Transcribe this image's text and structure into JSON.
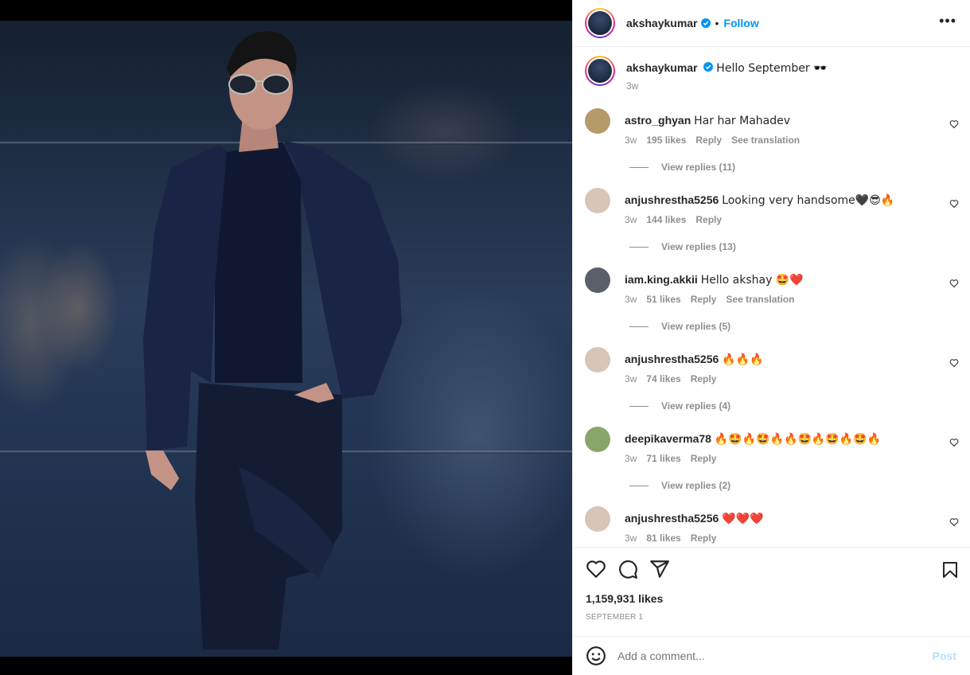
{
  "post": {
    "username": "akshaykumar",
    "follow_label": "Follow",
    "more_label": "•••",
    "caption": {
      "username": "akshaykumar",
      "text": "Hello September 🕶️",
      "age": "3w"
    },
    "likes": "1,159,931 likes",
    "date": "SEPTEMBER 1"
  },
  "comments": [
    {
      "username": "astro_ghyan",
      "text": "Har har Mahadev",
      "age": "3w",
      "likes": "195 likes",
      "reply": "Reply",
      "translation": "See translation",
      "view_replies": "View replies (11)",
      "avatar_color": "#b59a6a"
    },
    {
      "username": "anjushrestha5256",
      "text": "Looking very handsome🖤😎🔥",
      "age": "3w",
      "likes": "144 likes",
      "reply": "Reply",
      "translation": "",
      "view_replies": "View replies (13)",
      "avatar_color": "#d9c4b8"
    },
    {
      "username": "iam.king.akkii",
      "text": "Hello akshay 🤩❤️",
      "age": "3w",
      "likes": "51 likes",
      "reply": "Reply",
      "translation": "See translation",
      "view_replies": "View replies (5)",
      "avatar_color": "#5a5f6a"
    },
    {
      "username": "anjushrestha5256",
      "text": "🔥🔥🔥",
      "age": "3w",
      "likes": "74 likes",
      "reply": "Reply",
      "translation": "",
      "view_replies": "View replies (4)",
      "avatar_color": "#d9c4b8"
    },
    {
      "username": "deepikaverma78",
      "text": "🔥🤩🔥🤩🔥🔥🤩🔥🤩🔥🤩🔥",
      "age": "3w",
      "likes": "71 likes",
      "reply": "Reply",
      "translation": "",
      "view_replies": "View replies (2)",
      "avatar_color": "#8aa56a"
    },
    {
      "username": "anjushrestha5256",
      "text": "❤️❤️❤️",
      "age": "3w",
      "likes": "81 likes",
      "reply": "Reply",
      "translation": "",
      "view_replies": "",
      "avatar_color": "#d9c4b8"
    }
  ],
  "add_comment": {
    "placeholder": "Add a comment...",
    "post_label": "Post"
  },
  "colors": {
    "accent": "#0095f6",
    "muted": "#8e8e8e",
    "post_disabled": "#b2dffc"
  },
  "icons": [
    "verified-icon",
    "more-icon",
    "heart-icon",
    "comment-icon",
    "share-icon",
    "bookmark-icon",
    "emoji-icon",
    "small-heart-icon"
  ]
}
